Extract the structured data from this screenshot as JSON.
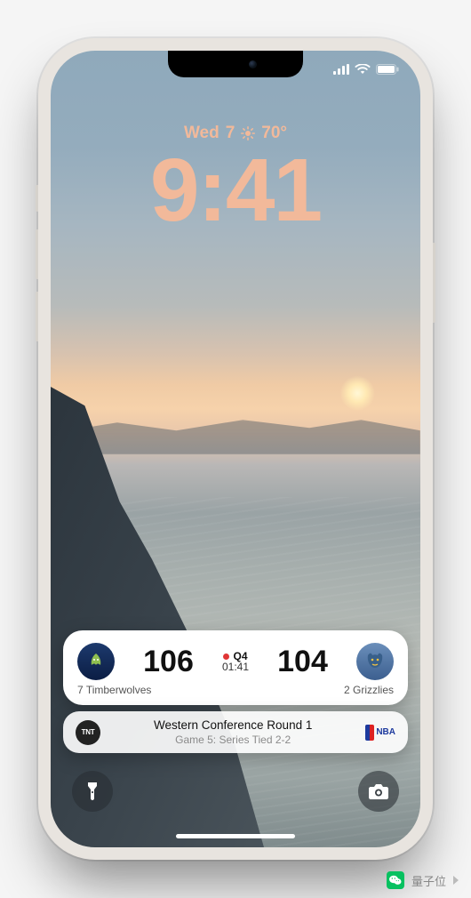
{
  "status": {
    "signal_bars": 4,
    "wifi": "wifi-icon",
    "battery_pct": 100
  },
  "lock": {
    "day": "Wed",
    "date": "7",
    "weather_icon": "sun",
    "temp": "70°",
    "time": "9:41"
  },
  "live_activity": {
    "away": {
      "seed": "7",
      "name": "Timberwolves",
      "score": "106",
      "logo_name": "timberwolves-logo"
    },
    "home": {
      "seed": "2",
      "name": "Grizzlies",
      "score": "104",
      "logo_name": "grizzlies-logo"
    },
    "period_label": "Q4",
    "clock": "01:41",
    "live": true,
    "context": {
      "network": "TNT",
      "title": "Western Conference Round 1",
      "subtitle": "Game 5: Series Tied 2-2",
      "league": "NBA"
    }
  },
  "quick_actions": {
    "flashlight": "flashlight-icon",
    "camera": "camera-icon"
  },
  "footer": {
    "source": "量子位"
  }
}
